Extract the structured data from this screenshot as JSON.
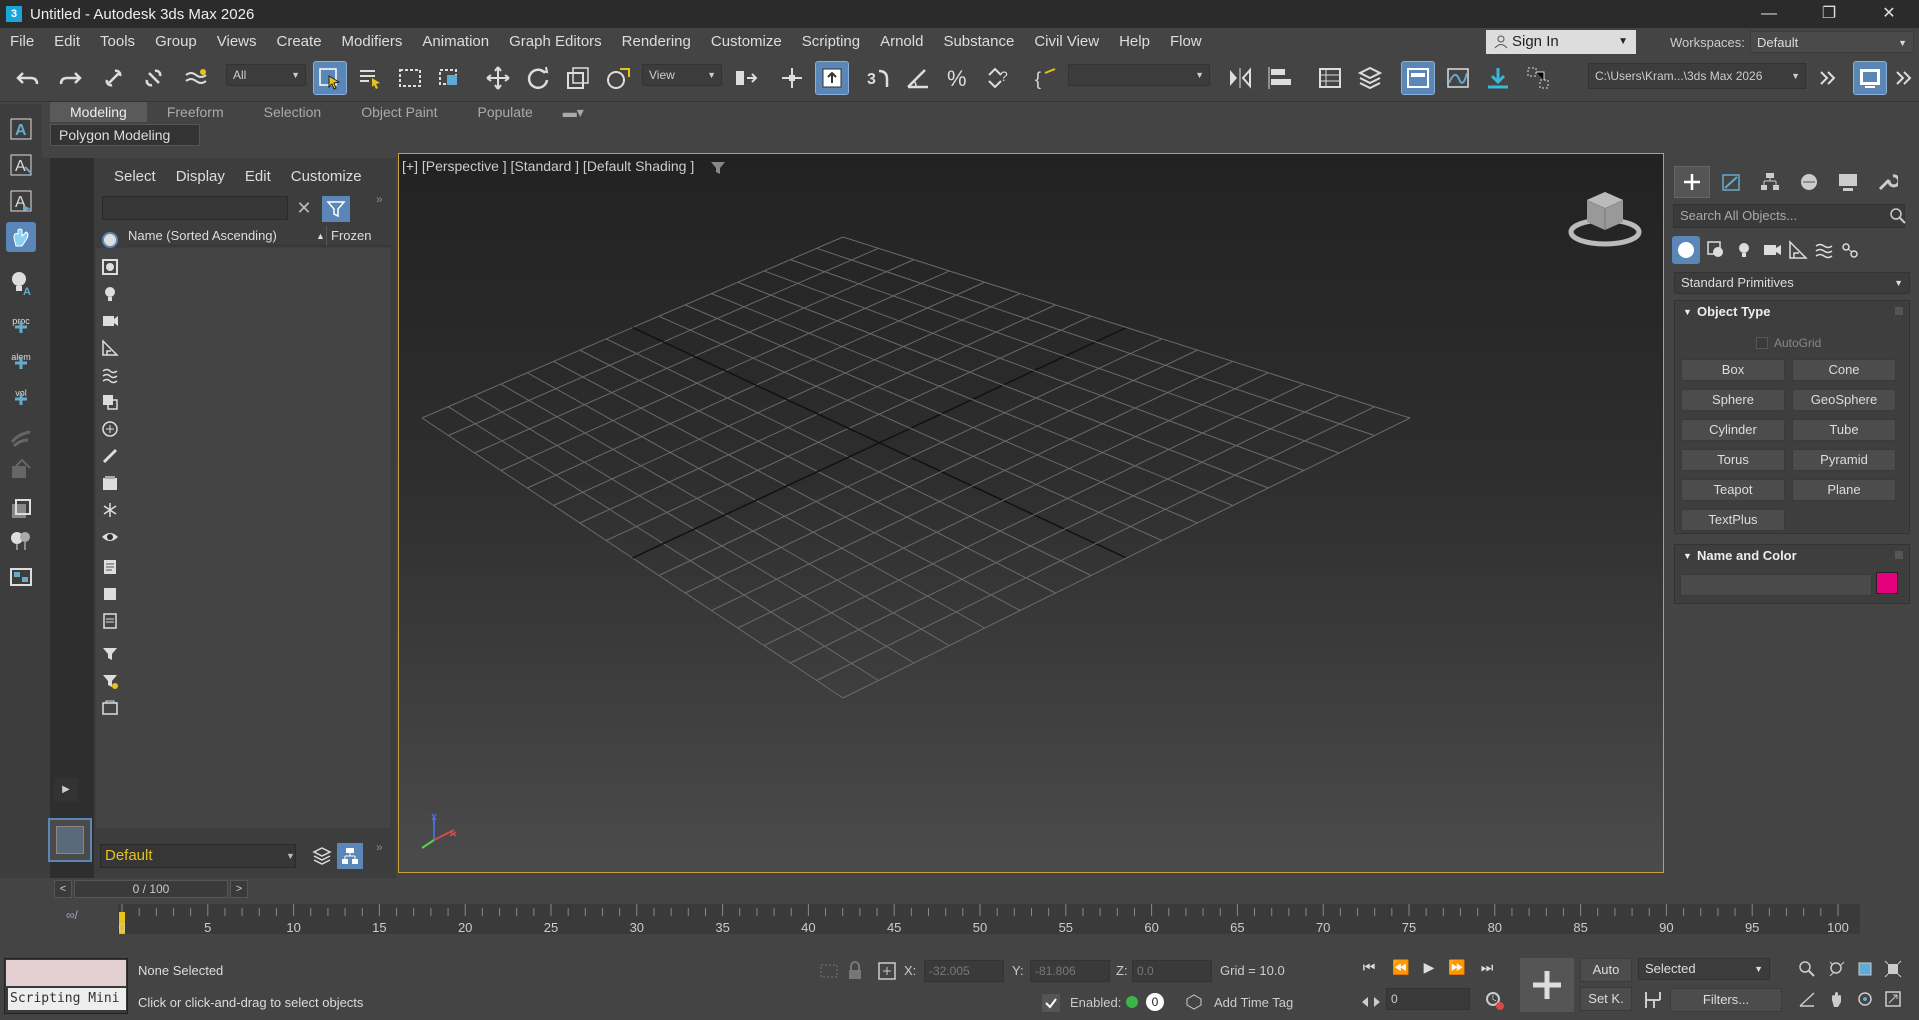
{
  "window": {
    "title": "Untitled - Autodesk 3ds Max 2026",
    "app_icon": "3",
    "controls": [
      "minimize-icon",
      "restore-icon",
      "close-icon"
    ]
  },
  "menu": {
    "items": [
      "File",
      "Edit",
      "Tools",
      "Group",
      "Views",
      "Create",
      "Modifiers",
      "Animation",
      "Graph Editors",
      "Rendering",
      "Customize",
      "Scripting",
      "Arnold",
      "Substance",
      "Civil View",
      "Help",
      "Flow"
    ],
    "sign_in": "Sign In",
    "workspaces_label": "Workspaces:",
    "workspace_value": "Default"
  },
  "toolbar": {
    "selection_filter": "All",
    "ref_coord": "View",
    "named_sel": "",
    "project_path": "C:\\Users\\Kram...\\3ds Max 2026"
  },
  "ribbon": {
    "tabs": [
      "Modeling",
      "Freeform",
      "Selection",
      "Object Paint",
      "Populate"
    ],
    "active_tab": "Modeling",
    "subpanel": "Polygon Modeling"
  },
  "left_icons": {
    "proc": "proc",
    "alem": "alem",
    "vol": "vol"
  },
  "scene_explorer": {
    "menu": [
      "Select",
      "Display",
      "Edit",
      "Customize"
    ],
    "search_value": "",
    "col_name": "Name (Sorted Ascending)",
    "col_frozen": "Frozen",
    "layer_value": "Default"
  },
  "viewport": {
    "label": "[+] [Perspective ] [Standard ] [Default Shading ]"
  },
  "command_panel": {
    "search_placeholder": "Search All Objects...",
    "category": "Standard Primitives",
    "object_type_title": "Object Type",
    "autogrid": "AutoGrid",
    "buttons": [
      "Box",
      "Cone",
      "Sphere",
      "GeoSphere",
      "Cylinder",
      "Tube",
      "Torus",
      "Pyramid",
      "Teapot",
      "Plane",
      "TextPlus"
    ],
    "name_color_title": "Name and Color",
    "object_color": "#e6007e"
  },
  "timeline": {
    "slider_text": "0 / 100",
    "prev": "<",
    "next": ">",
    "current_frame": 0,
    "ticks": [
      "0",
      "5",
      "10",
      "15",
      "20",
      "25",
      "30",
      "35",
      "40",
      "45",
      "50",
      "55",
      "60",
      "65",
      "70",
      "75",
      "80",
      "85",
      "90",
      "95",
      "100"
    ]
  },
  "status": {
    "script_label": "Scripting Mini",
    "selection_status": "None Selected",
    "prompt": "Click or click-and-drag to select objects",
    "x_label": "X:",
    "x_value": "-32.005",
    "y_label": "Y:",
    "y_value": "-81.806",
    "z_label": "Z:",
    "z_value": "0.0",
    "grid": "Grid = 10.0",
    "enabled_label": "Enabled:",
    "enabled_value": "0",
    "add_time_tag": "Add Time Tag",
    "auto": "Auto",
    "set_key": "Set K.",
    "selected": "Selected",
    "filters": "Filters...",
    "frame_value": "0"
  },
  "colors": {
    "accent": "#5a86b8",
    "viewport_border": "#c8a03a",
    "enabled": "#3bb54a",
    "layer_text": "#e6c21a"
  }
}
